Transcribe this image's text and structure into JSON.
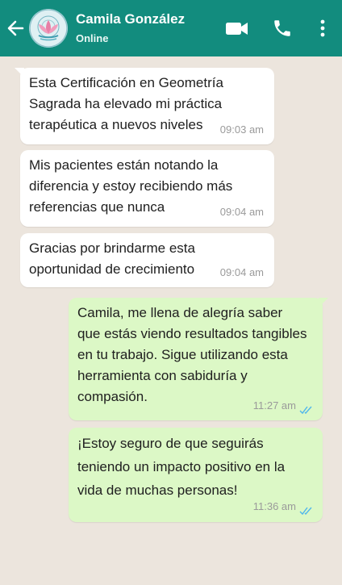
{
  "header": {
    "contact_name": "Camila González",
    "status": "Online"
  },
  "icons": {
    "back": "arrow-left-icon",
    "avatar": "lotus-logo",
    "video": "video-camera-icon",
    "phone": "phone-icon",
    "menu": "more-vertical-icon"
  },
  "colors": {
    "header": "#128c7e",
    "chat_background": "#ece5dd",
    "incoming_bubble": "#ffffff",
    "outgoing_bubble": "#dcf8c6",
    "read_receipt": "#4fb6ec"
  },
  "messages": [
    {
      "direction": "incoming",
      "lines": [
        "Esta Certificación en Geometría",
        "Sagrada ha elevado mi práctica",
        "terapéutica a nuevos niveles"
      ],
      "time": "09:03 am"
    },
    {
      "direction": "incoming",
      "lines": [
        "Mis pacientes están notando la",
        "diferencia y estoy recibiendo más",
        "referencias que nunca"
      ],
      "time": "09:04 am"
    },
    {
      "direction": "incoming",
      "lines": [
        "Gracias por brindarme esta",
        "oportunidad de crecimiento"
      ],
      "time": "09:04 am"
    },
    {
      "direction": "outgoing",
      "lines": [
        "Camila, me llena de alegría saber",
        "que estás viendo resultados tangibles",
        "en tu trabajo. Sigue utilizando esta",
        "herramienta con sabiduría y",
        "compasión."
      ],
      "time": "11:27 am",
      "read": true
    },
    {
      "direction": "outgoing",
      "lines": [
        "¡Estoy seguro de que seguirás",
        "teniendo un impacto positivo en la",
        "vida de muchas personas!"
      ],
      "time": "11:36 am",
      "read": true
    }
  ]
}
